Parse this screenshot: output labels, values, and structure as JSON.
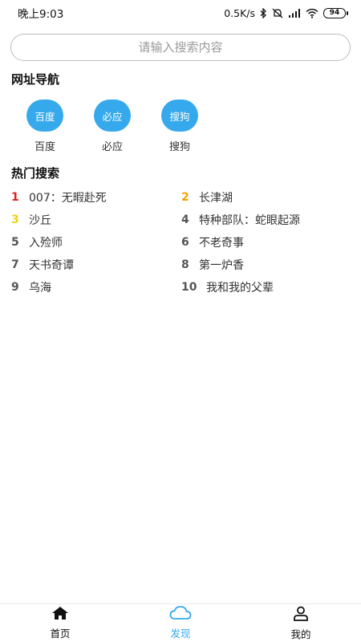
{
  "status": {
    "time": "晚上9:03",
    "speed": "0.5K/s",
    "battery": "94"
  },
  "search": {
    "placeholder": "请输入搜索内容"
  },
  "nav_section": {
    "title": "网址导航",
    "items": [
      {
        "circle": "百度",
        "label": "百度"
      },
      {
        "circle": "必应",
        "label": "必应"
      },
      {
        "circle": "搜狗",
        "label": "搜狗"
      }
    ]
  },
  "hot_section": {
    "title": "热门搜索",
    "items": [
      {
        "rank": "1",
        "text": "007：无暇赴死"
      },
      {
        "rank": "2",
        "text": "长津湖"
      },
      {
        "rank": "3",
        "text": "沙丘"
      },
      {
        "rank": "4",
        "text": "特种部队：蛇眼起源"
      },
      {
        "rank": "5",
        "text": "入殓师"
      },
      {
        "rank": "6",
        "text": "不老奇事"
      },
      {
        "rank": "7",
        "text": "天书奇谭"
      },
      {
        "rank": "8",
        "text": "第一炉香"
      },
      {
        "rank": "9",
        "text": "乌海"
      },
      {
        "rank": "10",
        "text": "我和我的父辈"
      }
    ],
    "rank_colors": {
      "1": "#e02020",
      "2": "#f0a20a",
      "3": "#ead41a",
      "default": "#555555"
    }
  },
  "bottom_nav": {
    "tabs": [
      {
        "label": "首页",
        "icon": "home-icon"
      },
      {
        "label": "发现",
        "icon": "cloud-icon",
        "active": true
      },
      {
        "label": "我的",
        "icon": "user-icon"
      }
    ],
    "active_color": "#36a9ec"
  },
  "colors": {
    "accent": "#36a9ec"
  }
}
